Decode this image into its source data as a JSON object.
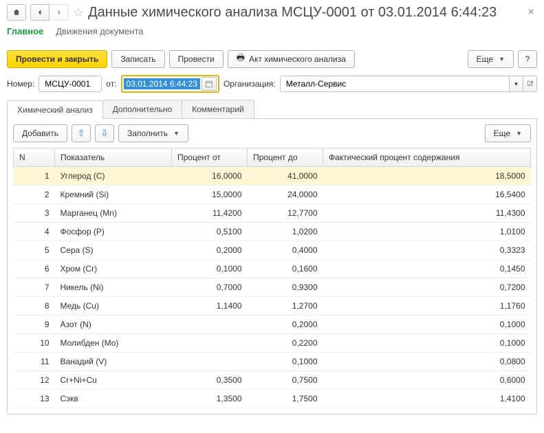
{
  "title": "Данные химического анализа МСЦУ-0001 от 03.01.2014 6:44:23",
  "viewTabs": {
    "main": "Главное",
    "movements": "Движения документа"
  },
  "cmd": {
    "postClose": "Провести и закрыть",
    "save": "Записать",
    "post": "Провести",
    "actPrint": "Акт химического анализа",
    "more": "Еще",
    "help": "?"
  },
  "form": {
    "numberLabel": "Номер:",
    "numberValue": "МСЦУ-0001",
    "fromLabel": "от:",
    "dateValue": "03.01.2014  6:44:23",
    "orgLabel": "Организация:",
    "orgValue": "Металл-Сервис"
  },
  "tabs": {
    "chem": "Химический анализ",
    "extra": "Дополнительно",
    "comment": "Комментарий"
  },
  "tableCmd": {
    "add": "Добавить",
    "fill": "Заполнить",
    "more": "Еще"
  },
  "columns": {
    "n": "N",
    "indicator": "Показатель",
    "from": "Процент от",
    "to": "Процент до",
    "fact": "Фактический процент содержания"
  },
  "rows": [
    {
      "n": "1",
      "ind": "Углерод (C)",
      "from": "16,0000",
      "to": "41,0000",
      "fact": "18,5000",
      "sel": true
    },
    {
      "n": "2",
      "ind": "Кремний (Si)",
      "from": "15,0000",
      "to": "24,0000",
      "fact": "16,5400"
    },
    {
      "n": "3",
      "ind": "Марганец (Mn)",
      "from": "11,4200",
      "to": "12,7700",
      "fact": "11,4300"
    },
    {
      "n": "4",
      "ind": "Фосфор (P)",
      "from": "0,5100",
      "to": "1,0200",
      "fact": "1,0100"
    },
    {
      "n": "5",
      "ind": "Сера (S)",
      "from": "0,2000",
      "to": "0,4000",
      "fact": "0,3323"
    },
    {
      "n": "6",
      "ind": "Хром (Cr)",
      "from": "0,1000",
      "to": "0,1600",
      "fact": "0,1450"
    },
    {
      "n": "7",
      "ind": "Никель (Ni)",
      "from": "0,7000",
      "to": "0,9300",
      "fact": "0,7200"
    },
    {
      "n": "8",
      "ind": "Медь (Cu)",
      "from": "1,1400",
      "to": "1,2700",
      "fact": "1,1760"
    },
    {
      "n": "9",
      "ind": "Азот (N)",
      "from": "",
      "to": "0,2000",
      "fact": "0,1000"
    },
    {
      "n": "10",
      "ind": "Молибден (Mo)",
      "from": "",
      "to": "0,2200",
      "fact": "0,1000"
    },
    {
      "n": "11",
      "ind": "Ванадий (V)",
      "from": "",
      "to": "0,1000",
      "fact": "0,0800"
    },
    {
      "n": "12",
      "ind": "Cr+Ni+Cu",
      "from": "0,3500",
      "to": "0,7500",
      "fact": "0,6000"
    },
    {
      "n": "13",
      "ind": "Сэкв",
      "from": "1,3500",
      "to": "1,7500",
      "fact": "1,4100"
    }
  ]
}
